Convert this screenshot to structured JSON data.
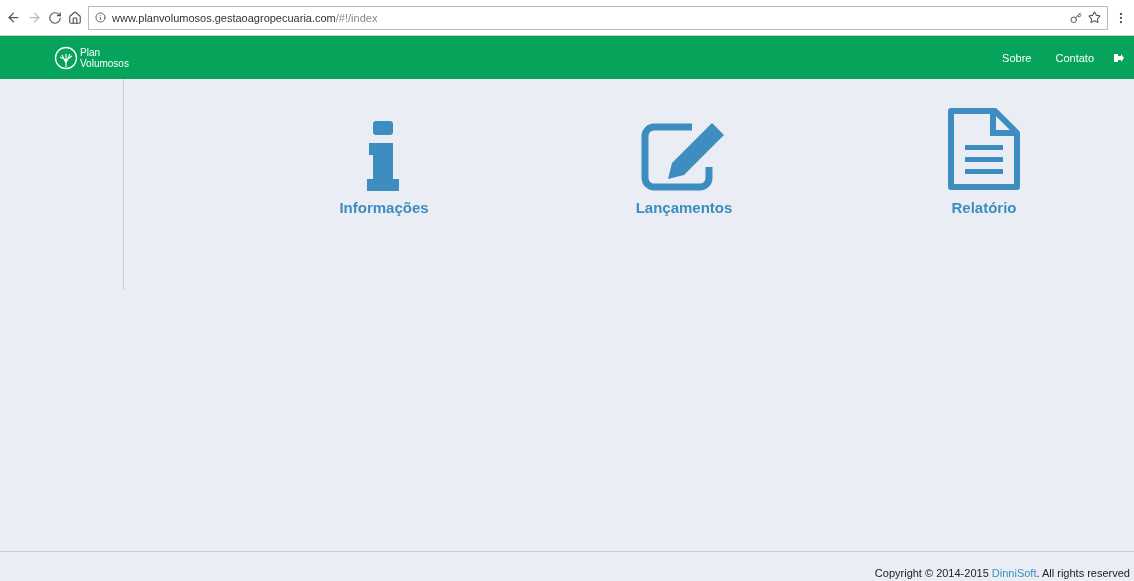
{
  "browser": {
    "url_host": "www.planvolumosos.gestaoagropecuaria.com",
    "url_path": "/#!/index"
  },
  "navbar": {
    "logo_lines": [
      "Plan",
      "Volumosos"
    ],
    "links": [
      "Sobre",
      "Contato"
    ]
  },
  "tiles": [
    {
      "kind": "info",
      "label": "Informações"
    },
    {
      "kind": "edit",
      "label": "Lançamentos"
    },
    {
      "kind": "report",
      "label": "Relatório"
    }
  ],
  "footer": {
    "before": "Copyright © 2014-2015 ",
    "link": "DinniSoft",
    "after": ". All rights reserved"
  }
}
